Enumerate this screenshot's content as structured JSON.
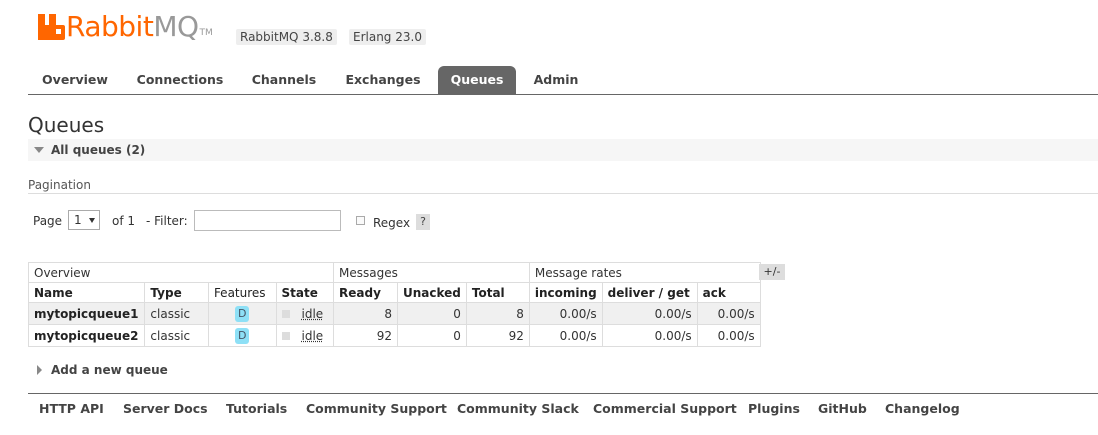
{
  "app": {
    "logo_rabbit": "Rabbit",
    "logo_mq": "MQ",
    "logo_tm": "TM",
    "rabbitmq_version": "RabbitMQ 3.8.8",
    "erlang_version": "Erlang 23.0",
    "brand_color": "#ff6600"
  },
  "tabs": [
    {
      "label": "Overview"
    },
    {
      "label": "Connections"
    },
    {
      "label": "Channels"
    },
    {
      "label": "Exchanges"
    },
    {
      "label": "Queues",
      "active": true
    },
    {
      "label": "Admin"
    }
  ],
  "page": {
    "title": "Queues",
    "section_title": "All queues (2)"
  },
  "pagination": {
    "label": "Pagination",
    "page_label": "Page",
    "page_value": "1",
    "of_label": "of 1",
    "filter_label": "- Filter:",
    "filter_value": "",
    "regex_label": "Regex",
    "help_label": "?"
  },
  "table": {
    "group_headers": {
      "overview": "Overview",
      "messages": "Messages",
      "rates": "Message rates"
    },
    "columns": [
      "Name",
      "Type",
      "Features",
      "State",
      "Ready",
      "Unacked",
      "Total",
      "incoming",
      "deliver / get",
      "ack"
    ],
    "toggle_label": "+/-",
    "rows": [
      {
        "name": "mytopicqueue1",
        "type": "classic",
        "feature": "D",
        "state": "idle",
        "ready": "8",
        "unacked": "0",
        "total": "8",
        "incoming": "0.00/s",
        "deliver_get": "0.00/s",
        "ack": "0.00/s"
      },
      {
        "name": "mytopicqueue2",
        "type": "classic",
        "feature": "D",
        "state": "idle",
        "ready": "92",
        "unacked": "0",
        "total": "92",
        "incoming": "0.00/s",
        "deliver_get": "0.00/s",
        "ack": "0.00/s"
      }
    ]
  },
  "add_queue_label": "Add a new queue",
  "footer": [
    {
      "label": "HTTP API"
    },
    {
      "label": "Server Docs"
    },
    {
      "label": "Tutorials"
    },
    {
      "label": "Community Support"
    },
    {
      "label": "Community Slack"
    },
    {
      "label": "Commercial Support"
    },
    {
      "label": "Plugins"
    },
    {
      "label": "GitHub"
    },
    {
      "label": "Changelog"
    }
  ]
}
